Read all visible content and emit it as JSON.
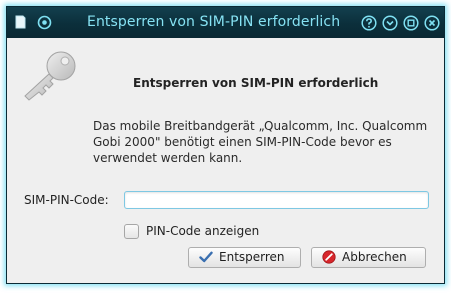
{
  "window": {
    "title": "Entsperren von SIM-PIN erforderlich",
    "accent": "#86e2f3",
    "titlebar_bg": "#0b2f3b"
  },
  "dialog": {
    "heading": "Entsperren von SIM-PIN erforderlich",
    "description": "Das mobile Breitbandgerät „Qualcomm, Inc. Qualcomm Gobi 2000\" benötigt einen SIM-PIN-Code bevor es verwendet werden kann.",
    "pin_label": "SIM-PIN-Code:",
    "pin_value": "",
    "show_pin_label": "PIN-Code anzeigen",
    "show_pin_checked": false,
    "unlock_label": "Entsperren",
    "cancel_label": "Abbrechen"
  },
  "icons": {
    "app": "document-icon",
    "menu": "circle-menu-icon",
    "help": "question-icon",
    "minimize": "chevron-down-icon",
    "maximize": "maximize-icon",
    "close": "close-icon",
    "key": "key-icon",
    "unlock": "checkmark-icon",
    "cancel": "stop-icon"
  }
}
